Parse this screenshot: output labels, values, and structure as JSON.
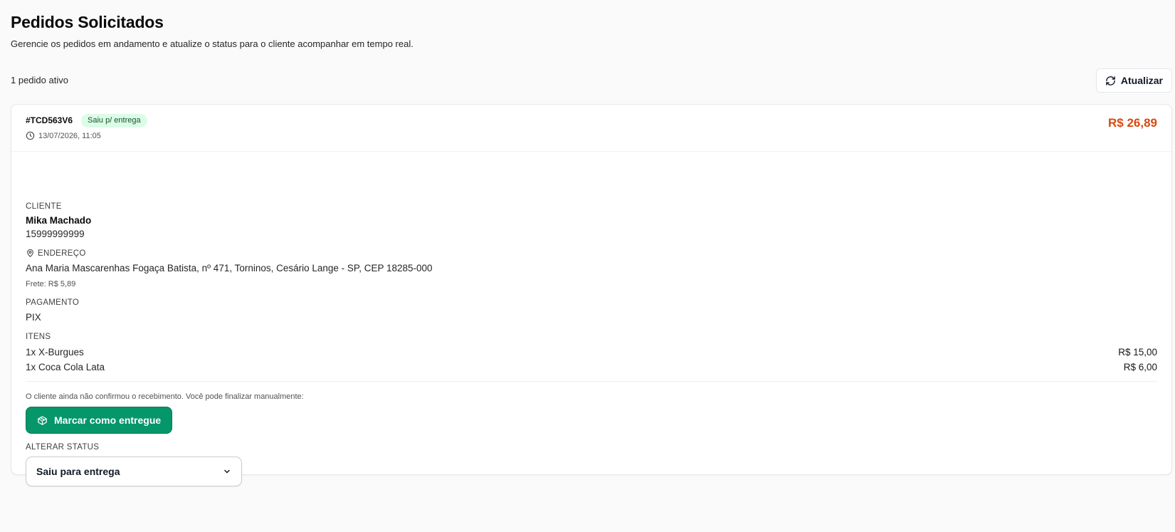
{
  "header": {
    "title": "Pedidos Solicitados",
    "subtitle": "Gerencie os pedidos em andamento e atualize o status para o cliente acompanhar em tempo real."
  },
  "toolbar": {
    "active_count": "1 pedido ativo",
    "refresh_label": "Atualizar",
    "refresh_icon": "refresh-icon"
  },
  "order": {
    "id": "#TCD563V6",
    "status_badge": "Saiu p/ entrega",
    "date": "13/07/2026, 11:05",
    "total": "R$ 26,89",
    "client": {
      "label": "CLIENTE",
      "name": "Mika Machado",
      "phone": "15999999999"
    },
    "address": {
      "label": "ENDEREÇO",
      "value": "Ana Maria Mascarenhas Fogaça Batista, nº 471, Torninos, Cesário Lange - SP, CEP 18285-000",
      "shipping": "Frete: R$ 5,89"
    },
    "payment": {
      "label": "PAGAMENTO",
      "value": "PIX"
    },
    "items": {
      "label": "ITENS",
      "list": [
        {
          "name": "1x X-Burgues",
          "price": "R$ 15,00"
        },
        {
          "name": "1x Coca Cola Lata",
          "price": "R$ 6,00"
        }
      ]
    },
    "hint": "O cliente ainda não confirmou o recebimento. Você pode finalizar manualmente:",
    "deliver_button": "Marcar como entregue",
    "status_change": {
      "label": "ALTERAR STATUS",
      "selected": "Saiu para entrega"
    }
  },
  "colors": {
    "accent_green": "#059669",
    "total_orange": "#d9480f",
    "badge_bg": "#dcfce7",
    "badge_text": "#14532d"
  }
}
